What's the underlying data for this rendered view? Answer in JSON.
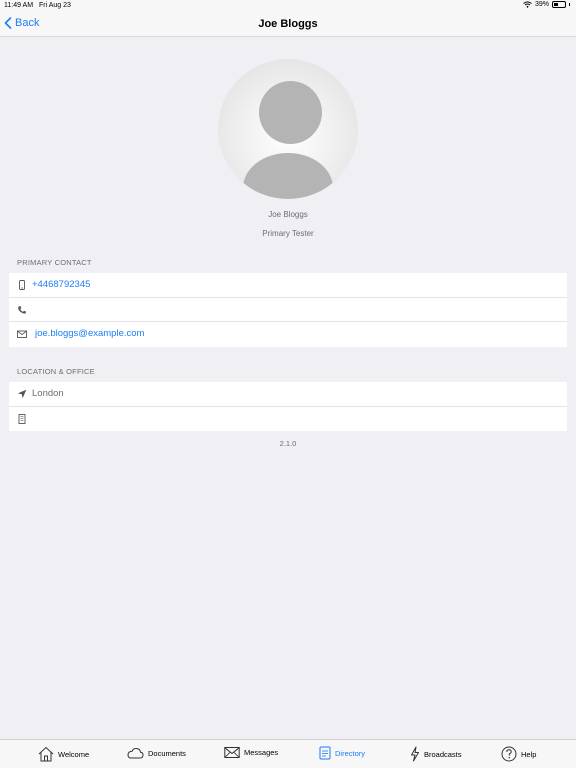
{
  "status": {
    "time": "11:49 AM",
    "date": "Fri Aug 23",
    "battery": "39%"
  },
  "nav": {
    "back_label": "Back",
    "title": "Joe Bloggs"
  },
  "profile": {
    "name": "Joe Bloggs",
    "role": "Primary Tester"
  },
  "primary_contact": {
    "header": "PRIMARY CONTACT",
    "mobile": "+4468792345",
    "phone": "",
    "email": "joe.bloggs@example.com"
  },
  "location": {
    "header": "LOCATION & OFFICE",
    "city": "London",
    "office": ""
  },
  "version": "2.1.0",
  "tabs": [
    {
      "label": "Welcome",
      "icon": "house-icon"
    },
    {
      "label": "Documents",
      "icon": "cloud-icon"
    },
    {
      "label": "Messages",
      "icon": "envelope-icon"
    },
    {
      "label": "Directory",
      "icon": "directory-icon",
      "active": true
    },
    {
      "label": "Broadcasts",
      "icon": "lightning-icon"
    },
    {
      "label": "Help",
      "icon": "question-icon"
    }
  ],
  "colors": {
    "accent": "#1b7ef7",
    "background": "#efeff4",
    "secondary_text": "#6d6d72"
  }
}
